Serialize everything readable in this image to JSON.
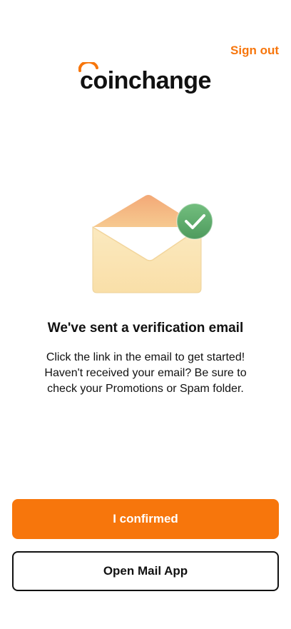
{
  "header": {
    "sign_out_label": "Sign out",
    "brand_name": "coinchange"
  },
  "illustration": {
    "icon": "envelope-check-icon"
  },
  "main": {
    "headline": "We've sent a verification email",
    "body_lines": [
      "Click the link in the email to get started!",
      "Haven't received your email? Be sure to",
      "check your Promotions or Spam folder."
    ]
  },
  "actions": {
    "confirm_label": "I confirmed",
    "open_mail_label": "Open Mail App"
  },
  "colors": {
    "accent": "#F7760C",
    "check_green": "#5DAA6B",
    "envelope_body": "#FBE6B8",
    "envelope_flap": "#F2B27E"
  }
}
